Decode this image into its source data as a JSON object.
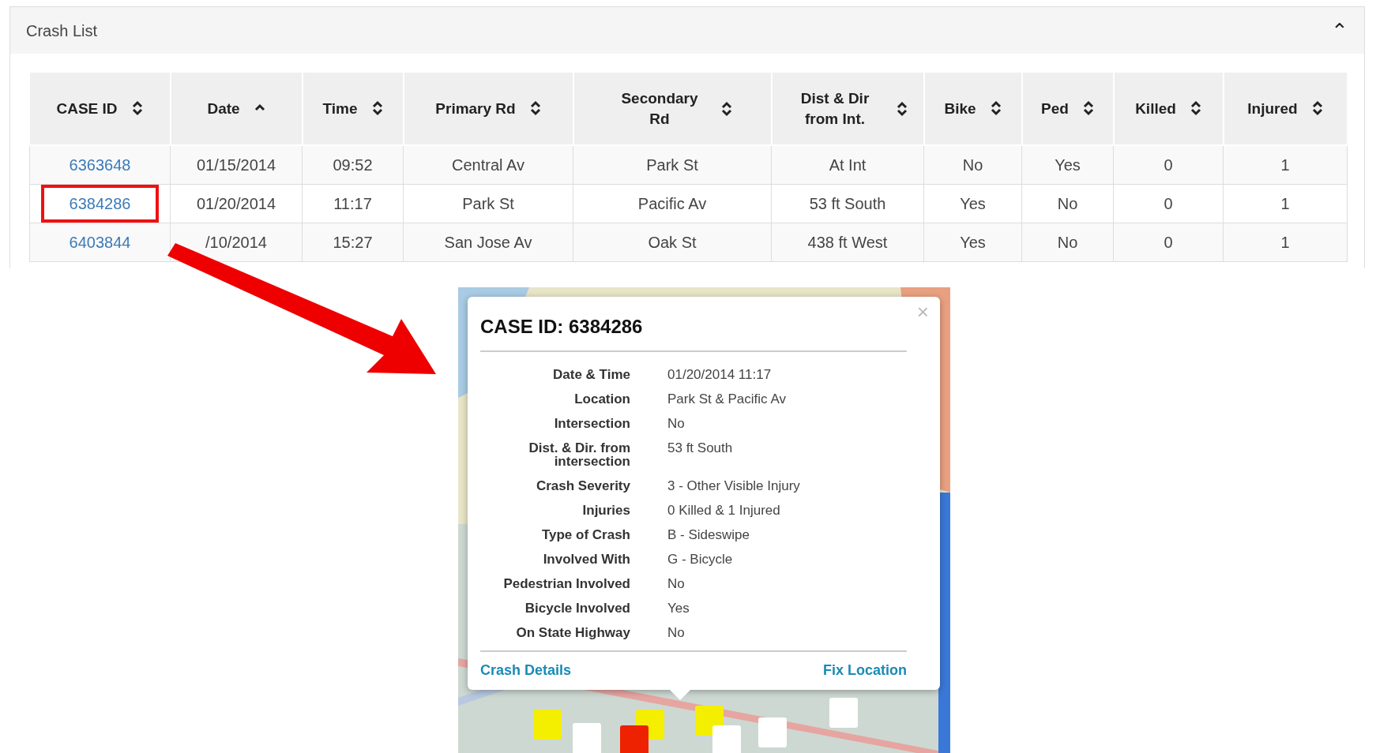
{
  "panel": {
    "title": "Crash List",
    "collapse_icon": "⌃"
  },
  "table": {
    "columns": [
      {
        "label": "CASE ID",
        "sorted": false
      },
      {
        "label": "Date",
        "sorted": true
      },
      {
        "label": "Time",
        "sorted": false
      },
      {
        "label": "Primary Rd",
        "sorted": false
      },
      {
        "label": "Secondary Rd",
        "sorted": false
      },
      {
        "label": "Dist & Dir from Int.",
        "sorted": false
      },
      {
        "label": "Bike",
        "sorted": false
      },
      {
        "label": "Ped",
        "sorted": false
      },
      {
        "label": "Killed",
        "sorted": false
      },
      {
        "label": "Injured",
        "sorted": false
      }
    ],
    "rows": [
      {
        "highlighted": false,
        "cells": [
          "6363648",
          "01/15/2014",
          "09:52",
          "Central Av",
          "Park St",
          "At Int",
          "No",
          "Yes",
          "0",
          "1"
        ]
      },
      {
        "highlighted": true,
        "cells": [
          "6384286",
          "01/20/2014",
          "11:17",
          "Park St",
          "Pacific Av",
          "53 ft South",
          "Yes",
          "No",
          "0",
          "1"
        ]
      },
      {
        "highlighted": false,
        "cells": [
          "6403844",
          "/10/2014",
          "15:27",
          "San Jose Av",
          "Oak St",
          "438 ft West",
          "Yes",
          "No",
          "0",
          "1"
        ]
      }
    ]
  },
  "popup": {
    "title": "CASE ID: 6384286",
    "close": "×",
    "fields": [
      {
        "label": "Date & Time",
        "value": "01/20/2014 11:17"
      },
      {
        "label": "Location",
        "value": "Park St & Pacific Av"
      },
      {
        "label": "Intersection",
        "value": "No"
      },
      {
        "label": "Dist. & Dir. from intersection",
        "value": "53 ft South"
      },
      {
        "label": "Crash Severity",
        "value": "3 - Other Visible Injury"
      },
      {
        "label": "Injuries",
        "value": "0 Killed & 1 Injured"
      },
      {
        "label": "Type of Crash",
        "value": "B - Sideswipe"
      },
      {
        "label": "Involved With",
        "value": "G - Bicycle"
      },
      {
        "label": "Pedestrian Involved",
        "value": "No"
      },
      {
        "label": "Bicycle Involved",
        "value": "Yes"
      },
      {
        "label": "On State Highway",
        "value": "No"
      }
    ],
    "links": [
      "Crash Details",
      "Fix Location"
    ]
  }
}
